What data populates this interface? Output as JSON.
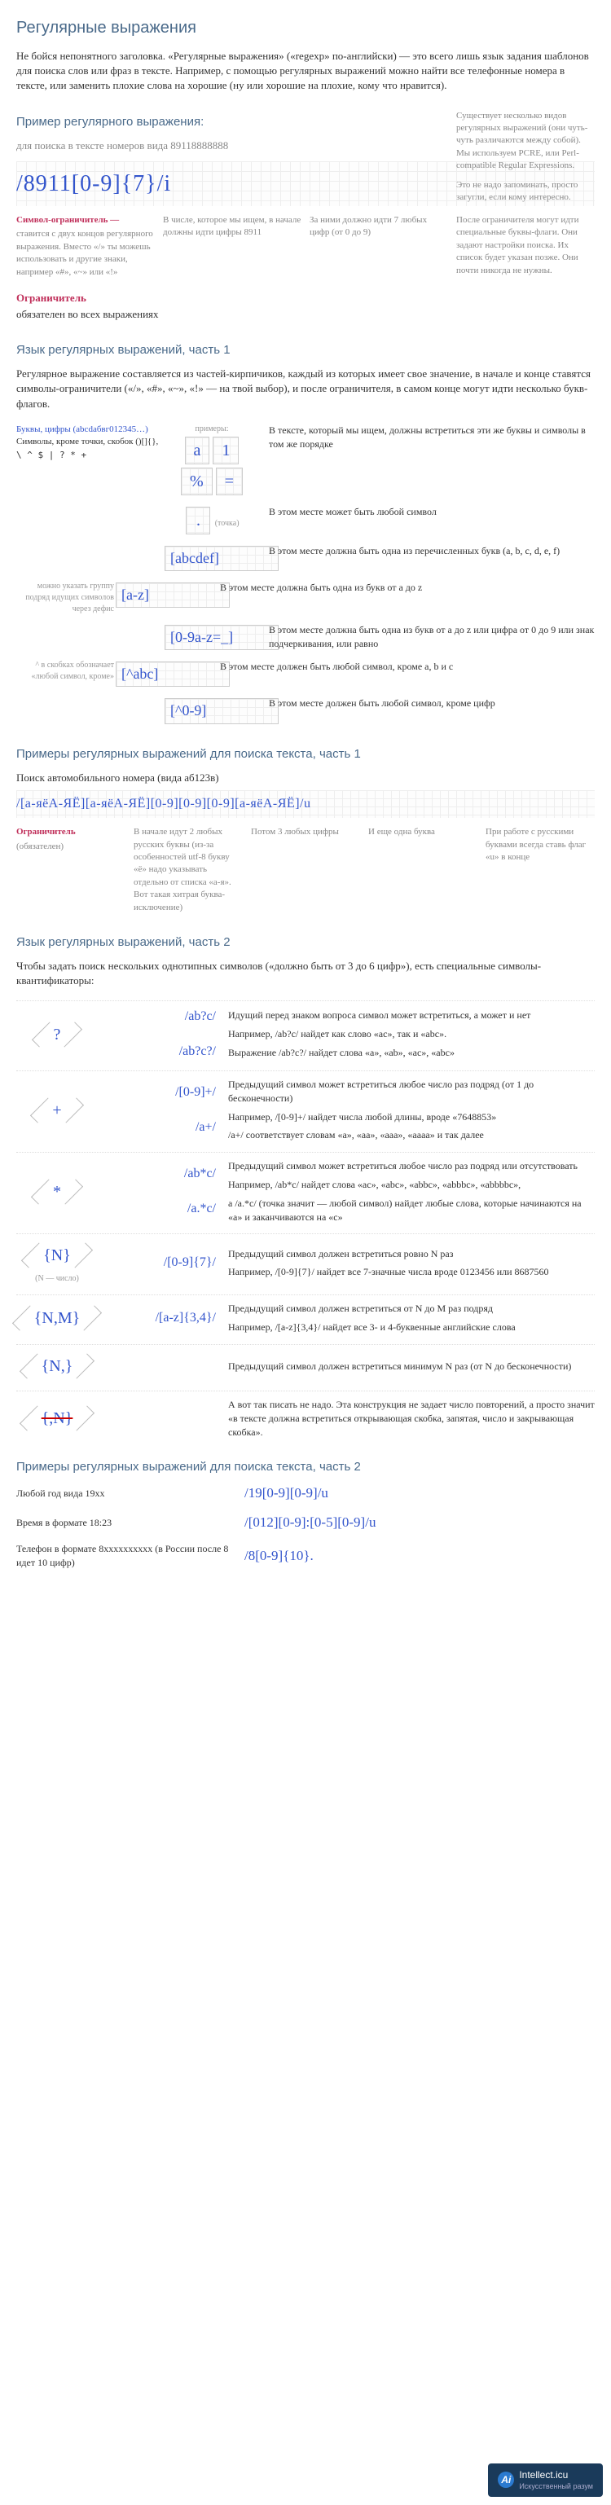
{
  "title": "Регулярные выражения",
  "intro": "Не бойся непонятного заголовка. «Регулярные выражения» («regexp» по-английски) — это всего лишь язык задания шаблонов для поиска слов или фраз в тексте. Например, с помощью регулярных выражений можно найти все телефонные номера в тексте, или заменить плохие слова на хорошие (ну или хорошие на плохие, кому что нравится).",
  "s1": {
    "heading": "Пример регулярного выражения:",
    "subtitle": "для поиска в тексте номеров вида 89118888888",
    "regex": "/8911[0-9]{7}/i",
    "side1": "Существует несколько видов регулярных выражений (они чуть-чуть различаются между собой). Мы используем PCRE, или Perl-compatible Regular Expressions.",
    "side2": "Это не надо запоминать, просто загугли, если кому интересно.",
    "a1t": "Символ-ограничитель —",
    "a1": "ставится с двух концов регулярного выражения. Вместо «/» ты можешь использовать и другие знаки, например «#», «~» или «!»",
    "a2": "В числе, которое мы ищем, в начале должны идти цифры 8911",
    "a3": "За ними должно идти 7 любых цифр (от 0 до 9)",
    "a4": "После ограничителя могут идти специальные буквы-флаги. Они задают настройки поиска. Их список будет указан позже. Они почти никогда не нужны.",
    "a5t": "Ограничитель",
    "a5": "обязателен во всех выражениях"
  },
  "s2": {
    "heading": "Язык регулярных выражений, часть 1",
    "intro": "Регулярное выражение составляется из частей-кирпичиков, каждый из которых имеет свое значение, в начале и конце ставятся символы-ограничители («/», «#», «~», «!» — на твой выбор), и после ограничителя, в самом конце могут идти несколько букв-флагов.",
    "r0l1": "Буквы, цифры (abcdабвг012345…)",
    "r0l2": "Символы, кроме точки, скобок ()[]{},",
    "r0l3": "\\ ^ $ | ? * +",
    "r0ex": "примеры:",
    "r0s": [
      "a",
      "1",
      "%",
      "="
    ],
    "r0d": "В тексте, который мы ищем, должны встретиться эти же буквы и символы в том же порядке",
    "r1s": ".",
    "r1l": "(точка)",
    "r1d": "В этом месте может быть любой символ",
    "r2s": "[abcdef]",
    "r2d": "В этом месте должна быть одна из перечисленных букв (a, b, c, d, e, f)",
    "r3s": "[a-z]",
    "r3g": "можно указать группу подряд идущих символов через дефис",
    "r3d": "В этом месте должна быть одна из букв от a до z",
    "r4s": "[0-9a-z=_]",
    "r4d": "В этом месте должна быть одна из букв от a до z или цифра от 0 до 9 или знак подчеркивания, или равно",
    "r5s": "[^abc]",
    "r5g": "^ в скобках обозначает «любой символ, кроме»",
    "r5d": "В этом месте должен быть любой символ, кроме a, b и c",
    "r6s": "[^0-9]",
    "r6d": "В этом месте должен быть любой символ, кроме цифр"
  },
  "s3": {
    "heading": "Примеры регулярных выражений для поиска текста, часть 1",
    "sub": "Поиск автомобильного номера (вида аб123в)",
    "regex": "/[а-яёА-ЯЁ][а-яёА-ЯЁ][0-9][0-9][0-9][а-яёА-ЯЁ]/u",
    "a1t": "Ограничитель",
    "a1": "(обязателен)",
    "a2": "В начале идут 2 любых русских буквы (из-за особенностей utf-8 букву «ё» надо указывать отдельно от списка «а-я». Вот такая хитрая буква-исключение)",
    "a3": "Потом 3 любых цифры",
    "a4": "И еще одна буква",
    "a5": "При работе с русскими буквами всегда ставь флаг «u» в конце"
  },
  "s4": {
    "heading": "Язык регулярных выражений, часть 2",
    "intro": "Чтобы задать поиск нескольких однотипных символов («должно быть от 3 до 6 цифр»), есть специальные символы-квантификаторы:",
    "rows": [
      {
        "sym": "?",
        "ex1": "/ab?c/",
        "d1": "Идущий перед знаком вопроса символ может встретиться, а может и нет",
        "d2": "Например, /ab?c/ найдет как слово «ac», так и «abc».",
        "ex2": "/ab?c?/",
        "d3": "Выражение /ab?c?/ найдет слова «a», «ab», «ac», «abc»"
      },
      {
        "sym": "+",
        "ex1": "/[0-9]+/",
        "d1": "Предыдущий символ может встретиться любое число раз подряд (от 1 до бесконечности)",
        "d2": "Например, /[0-9]+/ найдет числа любой длины, вроде «7648853»",
        "ex2": "/a+/",
        "d3": "/a+/ соответствует словам «a», «aa», «aaa», «aaaa» и так далее"
      },
      {
        "sym": "*",
        "ex1": "/ab*c/",
        "d1": "Предыдущий символ может встретиться любое число раз подряд или отсутствовать",
        "d2": "Например, /ab*c/ найдет слова «ac», «abc», «abbc», «abbbc», «abbbbc»,",
        "ex2": "/a.*c/",
        "d3": "а /a.*c/ (точка значит — любой символ) найдет любые слова, которые начинаются на «a» и заканчиваются на «c»"
      },
      {
        "sym": "{N}",
        "note": "(N — число)",
        "ex1": "/[0-9]{7}/",
        "d1": "Предыдущий символ должен встретиться ровно N раз",
        "d2": "Например, /[0-9]{7}/ найдет все 7-значные числа вроде 0123456 или 8687560"
      },
      {
        "sym": "{N,M}",
        "ex1": "/[a-z]{3,4}/",
        "d1": "Предыдущий символ должен встретиться от N до M раз подряд",
        "d2": "Например, /[a-z]{3,4}/ найдет все 3- и 4-буквенные английские слова"
      },
      {
        "sym": "{N,}",
        "d1": "Предыдущий символ должен встретиться минимум N раз (от N до бесконечности)"
      },
      {
        "sym": "{,N}",
        "strike": true,
        "d1": "А вот так писать не надо. Эта конструкция не задает число повторений, а просто значит «в тексте должна встретиться открывающая скобка, запятая, число и закрывающая скобка»."
      }
    ]
  },
  "s5": {
    "heading": "Примеры регулярных выражений для поиска текста, часть 2",
    "rows": [
      {
        "l": "Любой год вида 19xx",
        "r": "/19[0-9][0-9]/u"
      },
      {
        "l": "Время в формате 18:23",
        "r": "/[012][0-9]:[0-5][0-9]/u"
      },
      {
        "l": "Телефон в формате 8xxxxxxxxxx (в России после 8 идет 10 цифр)",
        "r": "/8[0-9]{10}."
      }
    ]
  },
  "footer": {
    "brand": "Intellect.icu",
    "tag": "Искусственный разум",
    "logo": "Ai"
  }
}
